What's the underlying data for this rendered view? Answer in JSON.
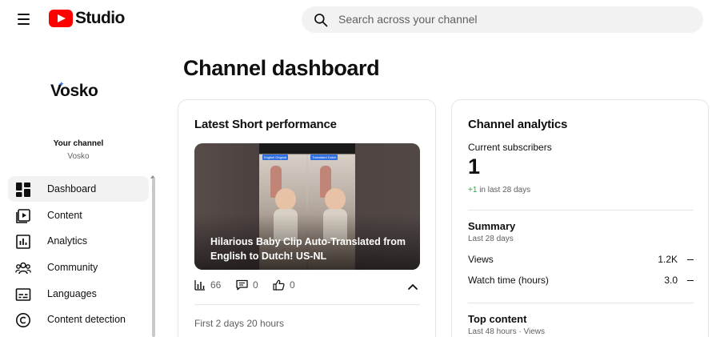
{
  "header": {
    "logo_text": "Studio",
    "search_placeholder": "Search across your channel"
  },
  "sidebar": {
    "brand": "Vosko",
    "your_channel_label": "Your channel",
    "channel_name": "Vosko",
    "items": [
      {
        "label": "Dashboard",
        "icon": "dashboard-icon",
        "active": true
      },
      {
        "label": "Content",
        "icon": "content-icon",
        "active": false
      },
      {
        "label": "Analytics",
        "icon": "analytics-icon",
        "active": false
      },
      {
        "label": "Community",
        "icon": "community-icon",
        "active": false
      },
      {
        "label": "Languages",
        "icon": "languages-icon",
        "active": false
      },
      {
        "label": "Content detection",
        "icon": "copyright-icon",
        "active": false
      }
    ]
  },
  "main": {
    "title": "Channel dashboard",
    "latest_short": {
      "title": "Latest Short performance",
      "video_title": "Hilarious Baby Clip Auto-Translated from English to Dutch! US-NL",
      "thumb_tags": [
        "English Original",
        "Translated Dutch"
      ],
      "views": "66",
      "comments": "0",
      "likes": "0",
      "period": "First 2 days 20 hours"
    },
    "analytics": {
      "title": "Channel analytics",
      "subscribers_label": "Current subscribers",
      "subscribers_value": "1",
      "subscribers_delta": "+1",
      "subscribers_delta_suffix": "in last 28 days",
      "summary_title": "Summary",
      "summary_period": "Last 28 days",
      "metrics": [
        {
          "label": "Views",
          "value": "1.2K"
        },
        {
          "label": "Watch time (hours)",
          "value": "3.0"
        }
      ],
      "top_content_title": "Top content",
      "top_content_period": "Last 48 hours · Views"
    }
  },
  "colors": {
    "brand_red": "#ff0000",
    "positive_green": "#2ba640",
    "active_nav_bg": "#f2f2f2",
    "muted_text": "#606060"
  }
}
